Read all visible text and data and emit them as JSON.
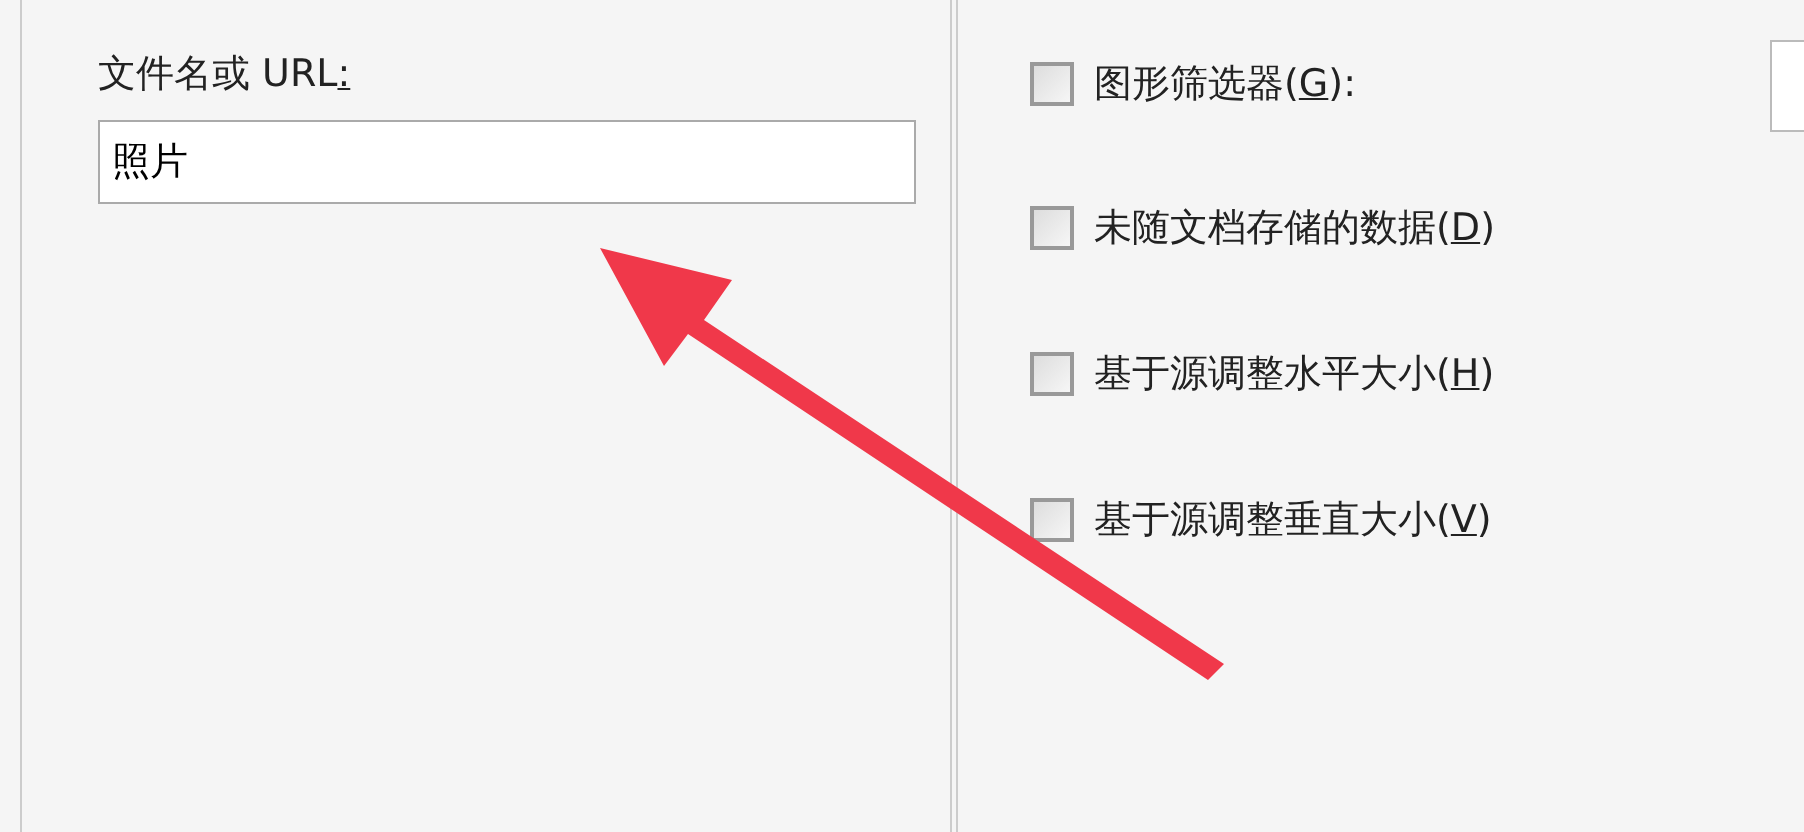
{
  "source_group": {
    "field_label": {
      "before": "文件名或 URL",
      "key": ":"
    },
    "field_value": "照片"
  },
  "options_group": {
    "checkboxes": [
      {
        "before": "图形筛选器(",
        "key": "G",
        "after": "):",
        "checked": false
      },
      {
        "before": "未随文档存储的数据(",
        "key": "D",
        "after": ")",
        "checked": false
      },
      {
        "before": "基于源调整水平大小(",
        "key": "H",
        "after": ")",
        "checked": false
      },
      {
        "before": "基于源调整垂直大小(",
        "key": "V",
        "after": ")",
        "checked": false
      }
    ],
    "filter_dropdown": {
      "kind": "dropdown"
    }
  },
  "annotation": {
    "kind": "arrow"
  }
}
